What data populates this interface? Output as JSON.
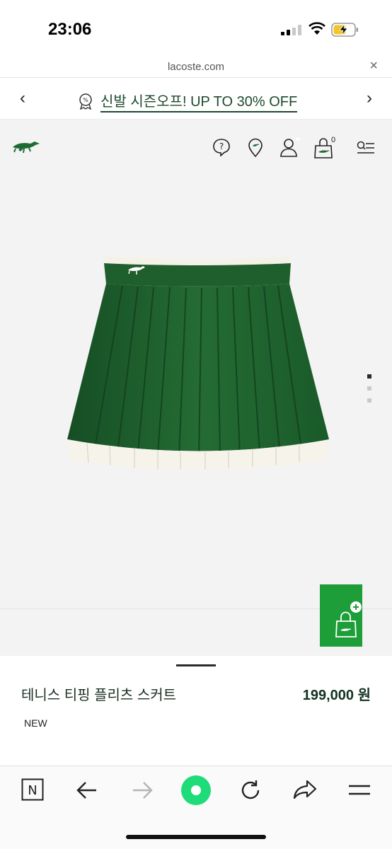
{
  "status_bar": {
    "time": "23:06"
  },
  "browser": {
    "url": "lacoste.com",
    "close_label": "×"
  },
  "promo": {
    "text": "신발 시즌오프! UP TO 30% OFF",
    "prev_label": "‹",
    "next_label": "›"
  },
  "header": {
    "cart_count": "0"
  },
  "product": {
    "name": "테니스 티핑 플리츠 스커트",
    "price": "199,000 원",
    "badge": "NEW",
    "gallery_images": 3,
    "active_image": 1
  },
  "colors": {
    "brand_green": "#1d9e38",
    "skirt_green": "#1f5f2d",
    "text_green": "#1d4a2c"
  },
  "icons": [
    "help-icon",
    "store-locator-icon",
    "account-icon",
    "cart-icon",
    "menu-icon",
    "add-to-cart-icon",
    "naver-n-icon",
    "back-icon",
    "forward-icon",
    "home-icon",
    "reload-icon",
    "share-icon",
    "hamburger-icon"
  ]
}
